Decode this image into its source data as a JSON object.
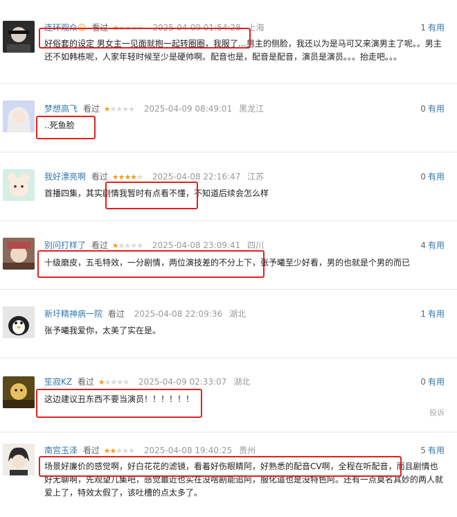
{
  "comments": [
    {
      "username": "连环观众",
      "seen": "看过",
      "rating": 1,
      "time": "2025-04-09 01:54:28",
      "location": "上海",
      "useful_count": "1",
      "useful_label": "有用",
      "text": "好俗套的设定 男女主一见面就抱一起转圈圈，我服了…男主的侧脸，我还以为是马可又来演男主了呢。。男主还不如韩栋呢，人家年轻时候至少是硬帅啊。配音也是，配音是配音，演员是演员。。。抬走吧。。。"
    },
    {
      "username": "梦想高飞",
      "seen": "看过",
      "rating": 1,
      "time": "2025-04-09 08:49:01",
      "location": "黑龙江",
      "useful_count": "0",
      "useful_label": "有用",
      "text": "..死鱼脸"
    },
    {
      "username": "我好漂亮啊",
      "seen": "看过",
      "rating": 4,
      "time": "2025-04-08 22:16:47",
      "location": "江苏",
      "useful_count": "0",
      "useful_label": "有用",
      "text": "首播四集，其实剧情我暂时有点看不懂，不知道后续会怎么样"
    },
    {
      "username": "别问打样了",
      "seen": "看过",
      "rating": 1,
      "time": "2025-04-08 23:09:41",
      "location": "四川",
      "useful_count": "4",
      "useful_label": "有用",
      "text": "十级磨皮，五毛特效，一分剧情，两位演技差的不分上下，张予曦至少好看，男的也就是个男的而已"
    },
    {
      "username": "新圩精神病一院",
      "seen": "看过",
      "rating": 0,
      "time": "2025-04-08 22:09:36",
      "location": "湖北",
      "useful_count": "1",
      "useful_label": "有用",
      "text": "张予曦我爱你，太美了实在是。"
    },
    {
      "username": "笙寂KZ",
      "seen": "看过",
      "rating": 1,
      "time": "2025-04-09 02:33:07",
      "location": "湖北",
      "useful_count": "0",
      "useful_label": "有用",
      "text": "这边建议丑东西不要当演员！！！！！！"
    },
    {
      "username": "南宫玉泽",
      "seen": "看过",
      "rating": 2,
      "time": "2025-04-08 19:40:25",
      "location": "贵州",
      "useful_count": "5",
      "useful_label": "有用",
      "text": "场景好廉价的感觉啊，好白花花的滤镜，看着好伤眼睛阿，好熟悉的配音CV啊，全程在听配音，而且剧情也好无聊啊，先观望几集吧，感觉最近也实在没啥剧能追阿，服化道也是没特色阿。还有一点莫名其妙的两人就爱上了，特效太假了，该吐槽的点太多了。"
    }
  ],
  "report_label": "投诉",
  "colors": {
    "link": "#3377aa",
    "star": "#f0a021",
    "highlight": "#e02020"
  },
  "icons": {
    "emoji_after_name": "smiley-emoji-icon"
  }
}
